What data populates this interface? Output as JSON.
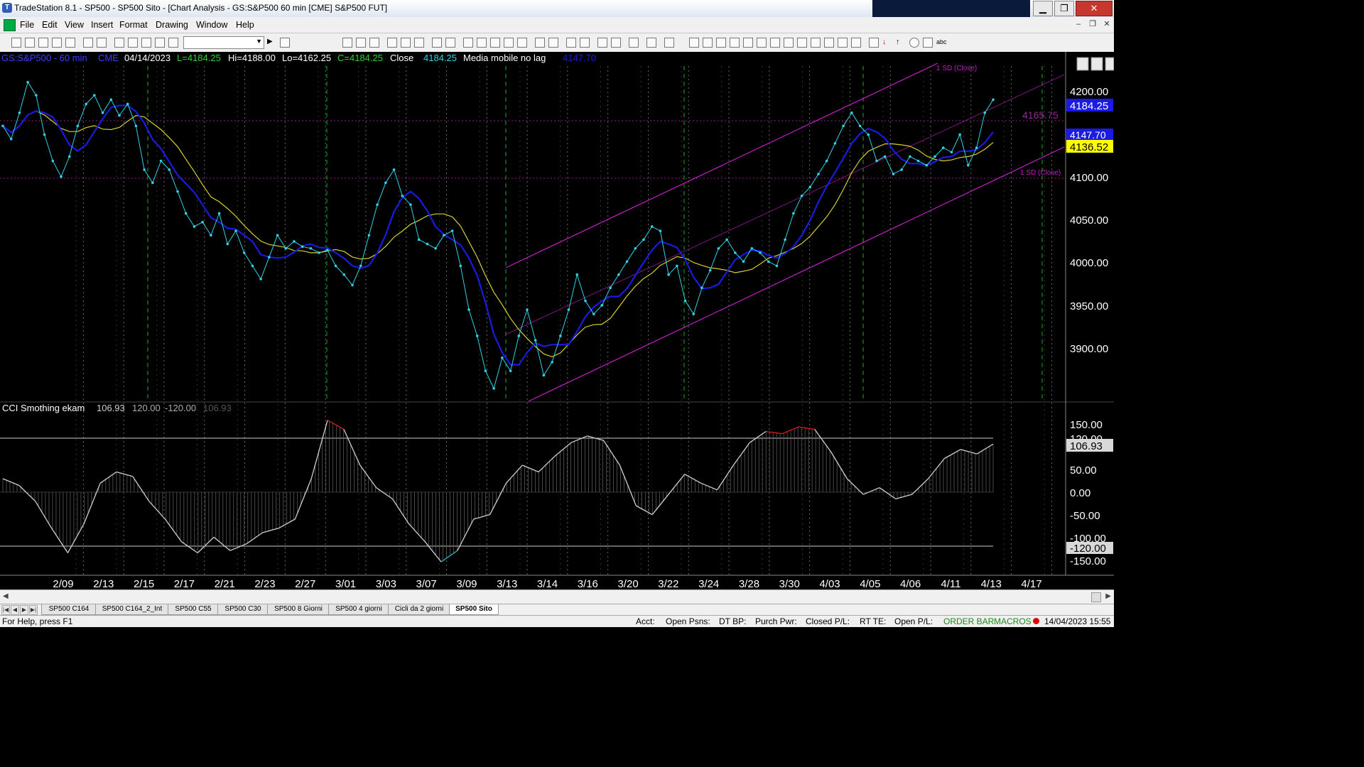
{
  "window": {
    "title": "TradeStation 8.1 - SP500 - SP500 Sito - [Chart Analysis - GS:S&P500  60 min  [CME] S&P500 FUT]",
    "buttons": [
      "▁",
      "❐",
      "✕"
    ]
  },
  "menu": {
    "items": [
      "File",
      "Edit",
      "View",
      "Insert",
      "Format",
      "Drawing",
      "Window",
      "Help"
    ],
    "mdi_buttons": [
      "–",
      "❐",
      "✕"
    ]
  },
  "chart": {
    "header": {
      "symbol": "GS:S&P500 - 60 min",
      "exchange": "CME",
      "date": "04/14/2023",
      "last": "L=4184.25",
      "high": "Hi=4188.00",
      "low": "Lo=4162.25",
      "close": "C=4184.25",
      "close_label": "Close",
      "close_value": "4184.25",
      "ma_label": "Media mobile no lag",
      "ma_value": "4147.70"
    },
    "sd_upper_label": "1 SD (Close)",
    "sd_lower_label": "1 SD (Close)",
    "level_label": "4165.75",
    "price_ticks": [
      "4200.00",
      "4100.00",
      "4050.00",
      "4000.00",
      "3950.00",
      "3900.00"
    ],
    "badges": {
      "last": "4184.25",
      "blue": "4147.70",
      "yellow": "4136.52"
    },
    "x_labels": [
      "2/09",
      "2/13",
      "2/15",
      "2/17",
      "2/21",
      "2/23",
      "2/27",
      "3/01",
      "3/03",
      "3/07",
      "3/09",
      "3/13",
      "3/14",
      "3/16",
      "3/20",
      "3/22",
      "3/24",
      "3/28",
      "3/30",
      "4/03",
      "4/05",
      "4/06",
      "4/11",
      "4/13",
      "4/17"
    ]
  },
  "cci": {
    "label": "CCI Smothing ekam",
    "value": "106.93",
    "upper": "120.00",
    "lower": "-120.00",
    "value_dim": "106.93",
    "ticks": [
      "150.00",
      "120.00",
      "50.00",
      "0.00",
      "-50.00",
      "-100.00",
      "-150.00"
    ],
    "badge_value": "106.93",
    "badge_lower": "-120.00"
  },
  "tabs": [
    "SP500 C164",
    "SP500 C164_2_Int",
    "SP500 C55",
    "SP500 C30",
    "SP500 8 Giorni",
    "SP500 4 giorni",
    "Cicli da 2 giorni",
    "SP500 Sito"
  ],
  "status": {
    "help": "For Help, press F1",
    "acct": "Acct:",
    "open_psns": "Open Psns:",
    "dt_bp": "DT BP:",
    "purch_pwr": "Purch Pwr:",
    "closed_pl": "Closed P/L:",
    "rt_te": "RT TE:",
    "open_pl": "Open P/L:",
    "order_bar": "ORDER BAR",
    "macros": "MACROS",
    "datetime": "14/04/2023 15:55"
  },
  "colors": {
    "price": "#2fd3e3",
    "ma_blue": "#1a1ae0",
    "ma_yellow": "#d8cf2a",
    "channel": "#c51ec5",
    "cycle": "#1fa81f",
    "cci_line": "#cfcfcf",
    "cci_high": "#e11b1b",
    "cci_low": "#28b4c4"
  },
  "chart_data": {
    "type": "line",
    "price_series": [
      4160,
      4145,
      4175,
      4210,
      4195,
      4150,
      4120,
      4102,
      4125,
      4160,
      4185,
      4195,
      4175,
      4190,
      4172,
      4185,
      4160,
      4110,
      4095,
      4120,
      4110,
      4085,
      4060,
      4045,
      4050,
      4035,
      4060,
      4025,
      4040,
      4015,
      4000,
      3985,
      4010,
      4035,
      4020,
      4028,
      4022,
      4020,
      4015,
      4018,
      4000,
      3990,
      3978,
      4000,
      4035,
      4070,
      4095,
      4110,
      4080,
      4070,
      4030,
      4025,
      4020,
      4035,
      4040,
      4000,
      3950,
      3920,
      3880,
      3860,
      3895,
      3880,
      3920,
      3950,
      3915,
      3875,
      3890,
      3920,
      3950,
      3990,
      3960,
      3945,
      3955,
      3975,
      3990,
      4005,
      4020,
      4030,
      4045,
      4040,
      3990,
      4000,
      3960,
      3945,
      3975,
      3995,
      4020,
      4030,
      4015,
      4005,
      4020,
      4015,
      4005,
      4000,
      4030,
      4060,
      4080,
      4090,
      4105,
      4120,
      4140,
      4160,
      4175,
      4160,
      4150,
      4120,
      4125,
      4105,
      4110,
      4125,
      4120,
      4115,
      4125,
      4135,
      4130,
      4150,
      4115,
      4135,
      4175,
      4190
    ],
    "cci_values": [
      30,
      15,
      -20,
      -80,
      -135,
      -70,
      20,
      45,
      35,
      -20,
      -60,
      -110,
      -135,
      -100,
      -130,
      -115,
      -90,
      -80,
      -60,
      30,
      160,
      140,
      60,
      10,
      -15,
      -70,
      -110,
      -155,
      -130,
      -60,
      -50,
      20,
      60,
      45,
      80,
      110,
      125,
      115,
      60,
      -30,
      -50,
      -5,
      40,
      20,
      5,
      60,
      110,
      135,
      130,
      145,
      140,
      90,
      30,
      -5,
      10,
      -15,
      -5,
      30,
      75,
      95,
      85,
      106.93
    ],
    "ylim": [
      3860,
      4210
    ],
    "cci_ylim": [
      -160,
      160
    ],
    "x": [
      "2/09",
      "2/13",
      "2/15",
      "2/17",
      "2/21",
      "2/23",
      "2/27",
      "3/01",
      "3/03",
      "3/07",
      "3/09",
      "3/13",
      "3/14",
      "3/16",
      "3/20",
      "3/22",
      "3/24",
      "3/28",
      "3/30",
      "4/03",
      "4/05",
      "4/06",
      "4/11",
      "4/13",
      "4/17"
    ],
    "grid": false
  }
}
